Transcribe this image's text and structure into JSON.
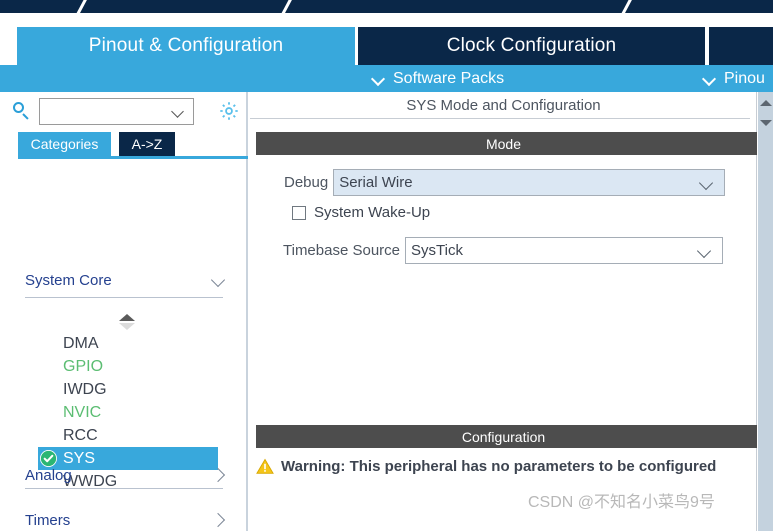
{
  "ribbon": {
    "slashes": [
      80,
      285,
      625
    ]
  },
  "tabs": [
    {
      "label": "Pinout & Configuration",
      "state": "active"
    },
    {
      "label": "Clock Configuration",
      "state": "inactive"
    },
    {
      "label": "",
      "state": "inactive"
    }
  ],
  "subbar": {
    "software_packs": "Software Packs",
    "pinout": "Pinou",
    "chevron_icon": "chevron-down-icon"
  },
  "sidebar": {
    "search": {
      "icon": "search-icon",
      "value": "",
      "placeholder": "",
      "caret_icon": "chevron-down-icon"
    },
    "gear_icon": "gear-icon",
    "tabs": [
      {
        "label": "Categories",
        "selected": true
      },
      {
        "label": "A->Z",
        "selected": false
      }
    ],
    "groups": [
      {
        "label": "System Core",
        "expanded": true,
        "chevron": "chevron-down-icon"
      },
      {
        "label": "Analog",
        "expanded": false,
        "chevron": "chevron-right-icon"
      },
      {
        "label": "Timers",
        "expanded": false,
        "chevron": "chevron-right-icon"
      }
    ],
    "scroll_indicator": "scroll-up-down-icon",
    "peripherals": [
      {
        "label": "DMA",
        "state": "normal"
      },
      {
        "label": "GPIO",
        "state": "configured"
      },
      {
        "label": "IWDG",
        "state": "normal"
      },
      {
        "label": "NVIC",
        "state": "configured"
      },
      {
        "label": "RCC",
        "state": "normal"
      },
      {
        "label": "SYS",
        "state": "selected",
        "check_icon": "check-circle-icon"
      },
      {
        "label": "WWDG",
        "state": "normal"
      }
    ]
  },
  "main": {
    "title": "SYS Mode and Configuration",
    "mode_section": "Mode",
    "config_section": "Configuration",
    "fields": {
      "debug_label": "Debug",
      "debug_value": "Serial Wire",
      "wakeup_label": "System Wake-Up",
      "wakeup_checked": false,
      "timebase_label": "Timebase Source",
      "timebase_value": "SysTick"
    },
    "warning": {
      "icon": "warning-triangle-icon",
      "text": "Warning: This peripheral has no parameters to be configured"
    },
    "watermark": "CSDN @不知名小菜鸟9号"
  },
  "scrollbar": {
    "up_icon": "scroll-up-arrow-icon",
    "down_icon": "scroll-down-arrow-icon"
  },
  "colors": {
    "accent_blue": "#38a8dc",
    "dark_navy": "#0a2748",
    "section_gray": "#4d4d4d",
    "green_configured": "#5bbd72",
    "warning_yellow": "#f5c518"
  }
}
